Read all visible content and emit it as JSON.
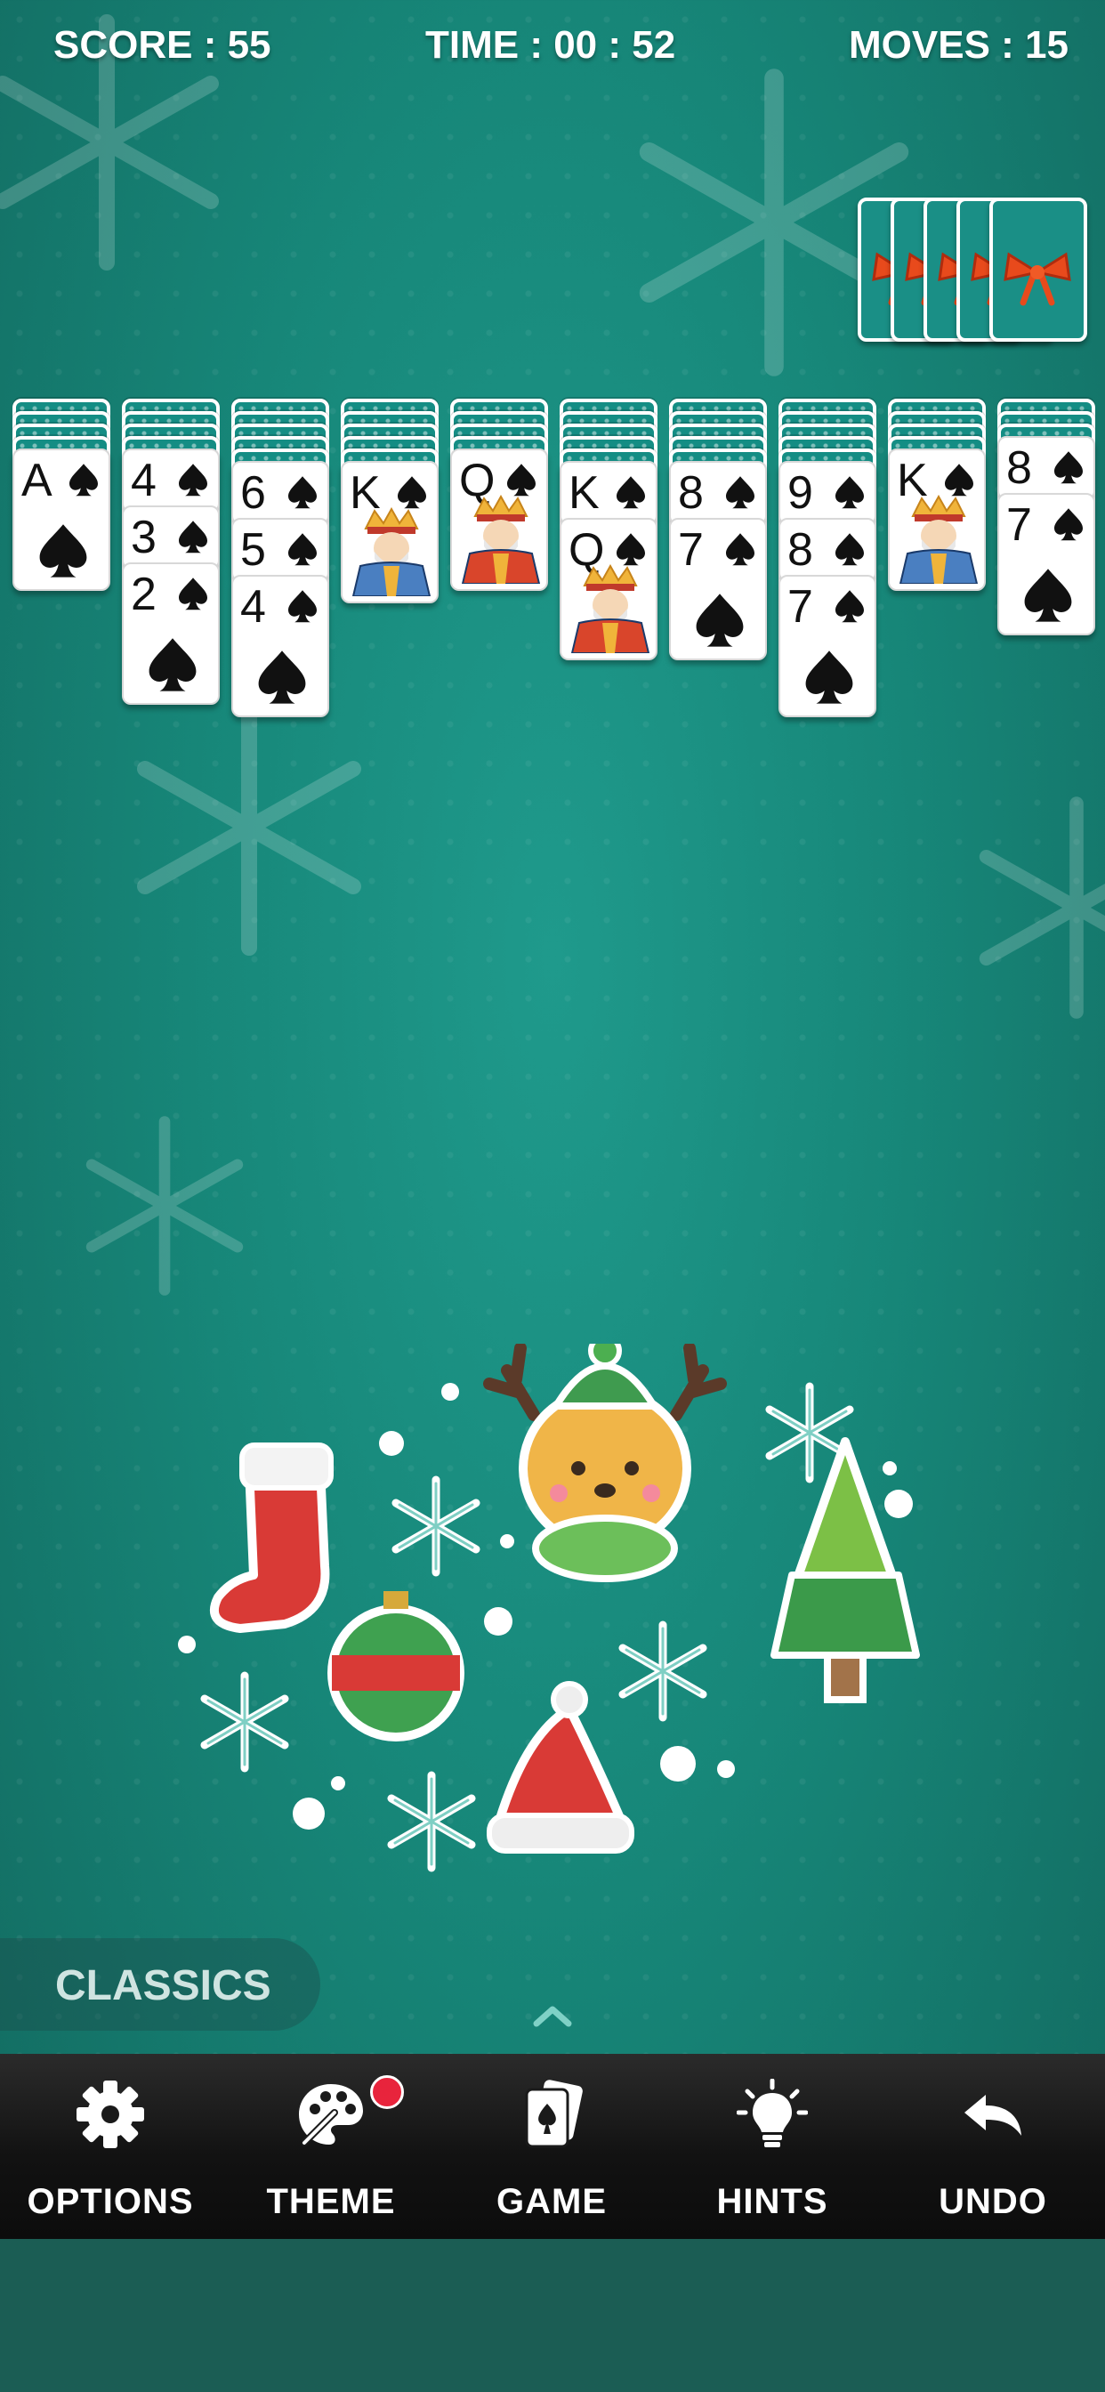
{
  "status": {
    "score_label": "SCORE : 55",
    "time_label": "TIME : 00 : 52",
    "moves_label": "MOVES : 15"
  },
  "stock": {
    "remaining_deals": 5
  },
  "tableau": [
    {
      "hidden": 4,
      "face_up": [
        "A"
      ]
    },
    {
      "hidden": 4,
      "face_up": [
        "4",
        "3",
        "2"
      ]
    },
    {
      "hidden": 5,
      "face_up": [
        "6",
        "5",
        "4"
      ]
    },
    {
      "hidden": 5,
      "face_up": [
        "K"
      ]
    },
    {
      "hidden": 4,
      "face_up": [
        "Q"
      ]
    },
    {
      "hidden": 5,
      "face_up": [
        "K",
        "Q"
      ]
    },
    {
      "hidden": 5,
      "face_up": [
        "8",
        "7"
      ]
    },
    {
      "hidden": 5,
      "face_up": [
        "9",
        "8",
        "7"
      ]
    },
    {
      "hidden": 4,
      "face_up": [
        "K"
      ]
    },
    {
      "hidden": 3,
      "face_up": [
        "8",
        "7"
      ]
    }
  ],
  "suit": "spades",
  "category_label": "CLASSICS",
  "toolbar": {
    "options_label": "OPTIONS",
    "theme_label": "THEME",
    "game_label": "GAME",
    "hints_label": "HINTS",
    "undo_label": "UNDO"
  },
  "colors": {
    "felt": "#178779",
    "card_back": "#148d84",
    "badge": "#e8243c",
    "bar": "#121212"
  },
  "icons": [
    "gear-icon",
    "palette-icon",
    "cards-icon",
    "lightbulb-icon",
    "undo-arrow-icon",
    "chevron-up-icon"
  ]
}
